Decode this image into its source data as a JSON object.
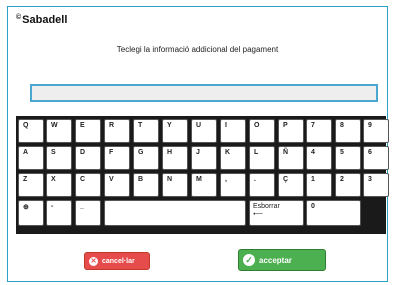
{
  "brand": {
    "logo_mark": "©",
    "logo_text": "Sabadell"
  },
  "prompt": "Teclegi la informació addicional del pagament",
  "input": {
    "value": ""
  },
  "keyboard": {
    "row1": [
      "Q",
      "W",
      "E",
      "R",
      "T",
      "Y",
      "U",
      "I",
      "O",
      "P",
      "7",
      "8",
      "9"
    ],
    "row2": [
      "A",
      "S",
      "D",
      "F",
      "G",
      "H",
      "J",
      "K",
      "L",
      "Ñ",
      "4",
      "5",
      "6"
    ],
    "row3": [
      "Z",
      "X",
      "C",
      "V",
      "B",
      "N",
      "M",
      ",",
      ".",
      "Ç",
      "1",
      "2",
      "3"
    ],
    "row4": {
      "shift": "⊕",
      "dash": "-",
      "underscore": "_",
      "space": "",
      "backspace": "Esborrar",
      "backspace_arrow": "⟵",
      "zero": "0"
    }
  },
  "buttons": {
    "cancel_label": "cancel·lar",
    "cancel_icon": "✕",
    "accept_label": "acceptar",
    "accept_icon": "✓"
  }
}
